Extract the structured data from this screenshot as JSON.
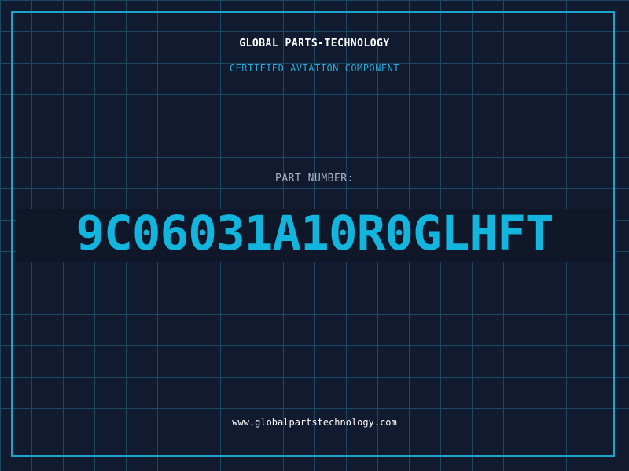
{
  "header": {
    "company": "GLOBAL PARTS-TECHNOLOGY",
    "tagline": "CERTIFIED AVIATION COMPONENT"
  },
  "part": {
    "label": "PART NUMBER:",
    "number": "9C06031A10R0GLHFT"
  },
  "footer": {
    "website": "www.globalpartstechnology.com"
  },
  "colors": {
    "background": "#111a2e",
    "grid": "#1b4a60",
    "border": "#1fa3c9",
    "accent": "#12b5dd",
    "label": "#aab4c4"
  }
}
